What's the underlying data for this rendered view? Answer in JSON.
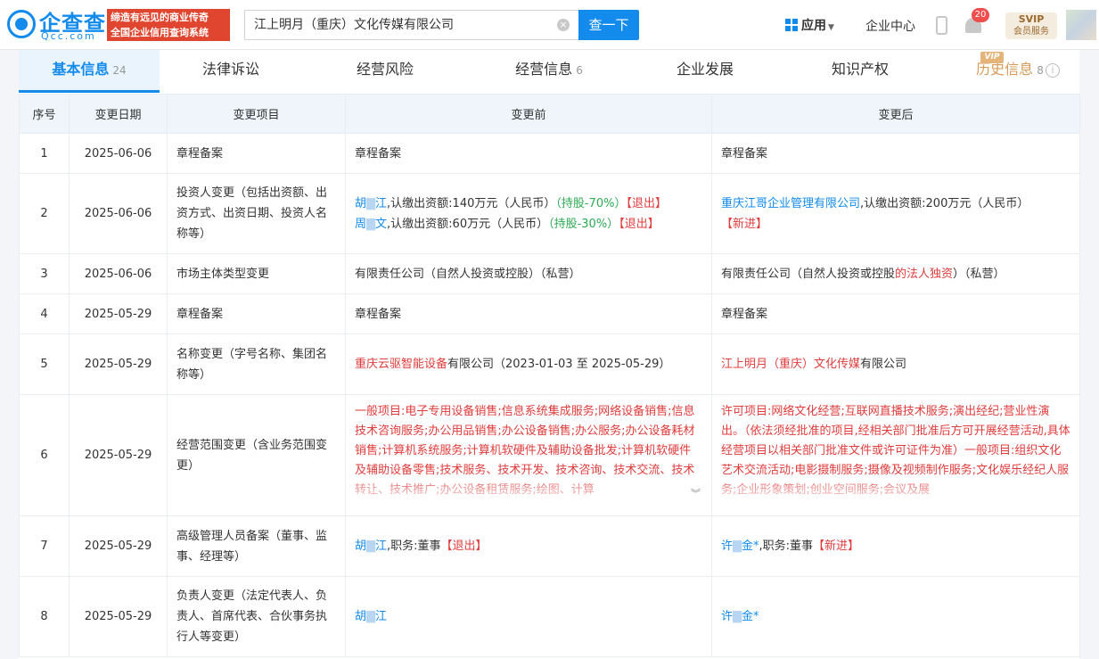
{
  "header": {
    "logo_cn": "企查查",
    "logo_en": "Qcc.com",
    "slogan_line1": "缔造有远见的商业传奇",
    "slogan_line2": "全国企业信用查询系统",
    "search_value": "江上明月（重庆）文化传媒有限公司",
    "search_button": "查一下",
    "app_menu": "应用",
    "center_link": "企业中心",
    "notification_count": "20",
    "svip_label": "SVIP",
    "svip_sub": "会员服务"
  },
  "tabs": [
    {
      "label": "基本信息",
      "count": "24"
    },
    {
      "label": "法律诉讼",
      "count": ""
    },
    {
      "label": "经营风险",
      "count": ""
    },
    {
      "label": "经营信息",
      "count": "6"
    },
    {
      "label": "企业发展",
      "count": ""
    },
    {
      "label": "知识产权",
      "count": ""
    },
    {
      "label": "历史信息",
      "count": "8"
    }
  ],
  "vip_tag": "VIP",
  "table": {
    "columns": [
      "序号",
      "变更日期",
      "变更项目",
      "变更前",
      "变更后"
    ],
    "rows": [
      {
        "index": "1",
        "date": "2025-06-06",
        "item": "章程备案",
        "before": "章程备案",
        "after": "章程备案"
      },
      {
        "index": "2",
        "date": "2025-06-06",
        "item": "投资人变更（包括出资额、出资方式、出资日期、投资人名称等）",
        "before_1_name_a": "胡",
        "before_1_name_b": "江",
        "before_1_amount": ",认缴出资额:140万元（人民币）",
        "before_1_share": "（持股-70%）",
        "before_1_tag": "【退出】",
        "before_2_name_a": "周",
        "before_2_name_b": "文",
        "before_2_amount": ",认缴出资额:60万元（人民币）",
        "before_2_share": "（持股-30%）",
        "before_2_tag": "【退出】",
        "after_1_name": "重庆江哥企业管理有限公司",
        "after_1_amount": ",认缴出资额:200万元（人民币）",
        "after_1_tag": "【新进】"
      },
      {
        "index": "3",
        "date": "2025-06-06",
        "item": "市场主体类型变更",
        "before": "有限责任公司（自然人投资或控股）（私营）",
        "after_a": "有限责任公司（自然人投资或控股",
        "after_b": "的法人独资",
        "after_c": "）（私营）"
      },
      {
        "index": "4",
        "date": "2025-05-29",
        "item": "章程备案",
        "before": "章程备案",
        "after": "章程备案"
      },
      {
        "index": "5",
        "date": "2025-05-29",
        "item": "名称变更（字号名称、集团名称等）",
        "before_a": "重庆云驱智能设备",
        "before_b": "有限公司（2023-01-03 至 2025-05-29）",
        "after_a": "江上明月（重庆）文化传媒",
        "after_b": "有限公司"
      },
      {
        "index": "6",
        "date": "2025-05-29",
        "item": "经营范围变更（含业务范围变更）",
        "before": "一般项目:电子专用设备销售;信息系统集成服务;网络设备销售;信息技术咨询服务;办公用品销售;办公设备销售;办公服务;办公设备耗材销售;计算机系统服务;计算机软硬件及辅助设备批发;计算机软硬件及辅助设备零售;技术服务、技术开发、技术咨询、技术交流、技术转让、技术推广;办公设备租赁服务;绘图、计算",
        "after": "许可项目:网络文化经营;互联网直播技术服务;演出经纪;营业性演出。（依法须经批准的项目,经相关部门批准后方可开展经营活动,具体经营项目以相关部门批准文件或许可证件为准）一般项目:组织文化艺术交流活动;电影摄制服务;摄像及视频制作服务;文化娱乐经纪人服务;企业形象策划;创业空间服务;会议及展"
      },
      {
        "index": "7",
        "date": "2025-05-29",
        "item": "高级管理人员备案（董事、监事、经理等）",
        "before_name_a": "胡",
        "before_name_b": "江",
        "before_role": ",职务:董事",
        "before_tag": "【退出】",
        "after_name_a": "许",
        "after_name_b": "金*",
        "after_role": ",职务:董事",
        "after_tag": "【新进】"
      },
      {
        "index": "8",
        "date": "2025-05-29",
        "item": "负责人变更（法定代表人、负责人、首席代表、合伙事务执行人等变更）",
        "before_name_a": "胡",
        "before_name_b": "江",
        "after_name_a": "许",
        "after_name_b": "金*"
      }
    ]
  },
  "colors": {
    "brand": "#128bed",
    "slogan_bg": "#e0462f",
    "green": "#2baa52",
    "red": "#e03c3c",
    "header_bg": "#eff5fb"
  }
}
